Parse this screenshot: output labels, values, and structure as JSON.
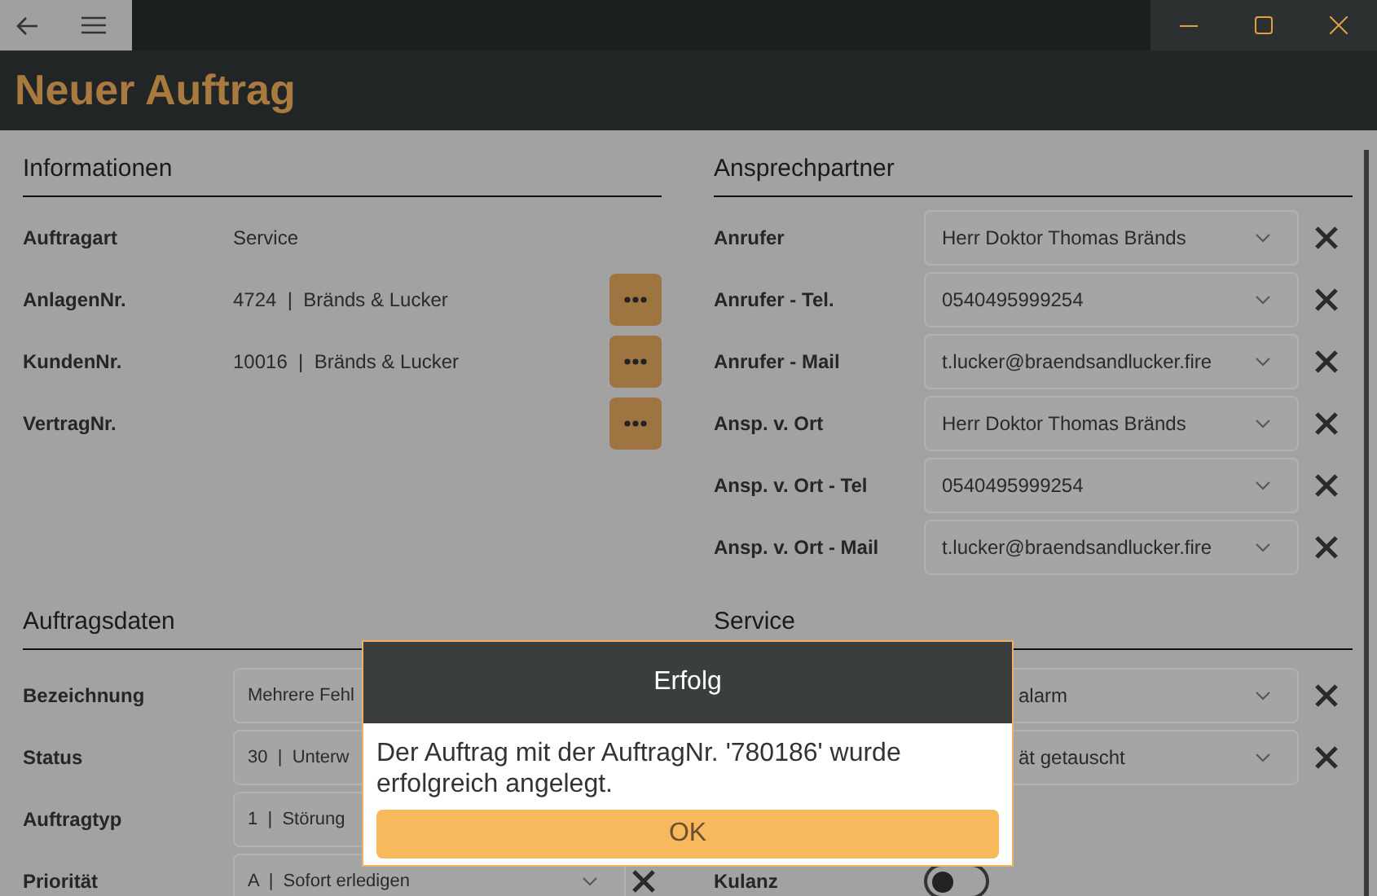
{
  "page_title": "Neuer Auftrag",
  "columns": [
    {
      "sections": [
        {
          "title": "Informationen",
          "rows": [
            {
              "kind": "text",
              "label": "Auftragart",
              "value": "Service"
            },
            {
              "kind": "lookup",
              "label": "AnlagenNr.",
              "value": "4724  |  Bränds & Lucker"
            },
            {
              "kind": "lookup",
              "label": "KundenNr.",
              "value": "10016  |  Bränds & Lucker"
            },
            {
              "kind": "lookup",
              "label": "VertragNr."
            }
          ]
        },
        {
          "title": "Auftragsdaten",
          "rows": [
            {
              "kind": "cut-select",
              "label": "Bezeichnung",
              "value": "Mehrere Fehl"
            },
            {
              "kind": "cut-select",
              "label": "Status",
              "value": "30  |  Unterw"
            },
            {
              "kind": "cut-select",
              "label": "Auftragtyp",
              "value": "1  |  Störung"
            },
            {
              "kind": "select",
              "label": "Priorität",
              "value": "A  |  Sofort erledigen",
              "clear": true
            }
          ]
        }
      ]
    },
    {
      "sections": [
        {
          "title": "Ansprechpartner",
          "rows": [
            {
              "kind": "select",
              "label": "Anrufer",
              "value": "Herr Doktor Thomas Bränds",
              "clear": true
            },
            {
              "kind": "select",
              "label": "Anrufer - Tel.",
              "value": "0540495999254",
              "clear": true
            },
            {
              "kind": "select",
              "label": "Anrufer - Mail",
              "value": "t.lucker@braendsandlucker.fire",
              "clear": true
            },
            {
              "kind": "select",
              "label": "Ansp. v. Ort",
              "value": "Herr Doktor Thomas Bränds",
              "clear": true
            },
            {
              "kind": "select",
              "label": "Ansp. v. Ort - Tel",
              "value": "0540495999254",
              "clear": true
            },
            {
              "kind": "select",
              "label": "Ansp. v. Ort - Mail",
              "value": "t.lucker@braendsandlucker.fire",
              "clear": true
            }
          ]
        },
        {
          "title": "Service",
          "rows": [
            {
              "kind": "covered-select",
              "value": "alarm",
              "clear": true
            },
            {
              "kind": "covered-select",
              "value": "ät getauscht",
              "clear": true
            },
            {
              "kind": "blank"
            },
            {
              "kind": "toggle",
              "label": "Kulanz",
              "on": false
            }
          ]
        }
      ]
    }
  ],
  "dialog": {
    "title": "Erfolg",
    "message": "Der Auftrag mit der AuftragNr. '780186' wurde erfolgreich angelegt.",
    "button": "OK"
  }
}
